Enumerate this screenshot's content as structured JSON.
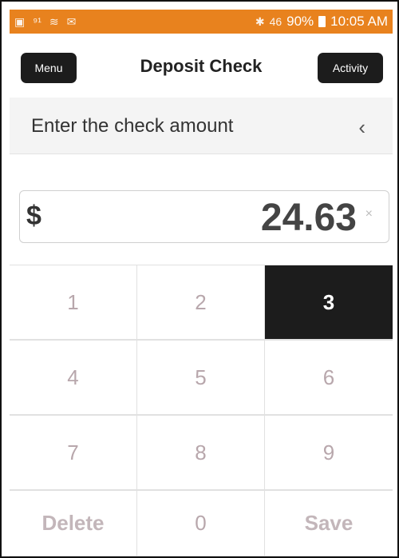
{
  "status_bar": {
    "time": "10:05 AM",
    "battery": "90%",
    "signal_text": "46"
  },
  "header": {
    "title": "Deposit Check",
    "menu_label": "Menu",
    "activity_label": "Activity"
  },
  "instruction": {
    "text": "Enter the check amount",
    "back_icon": "chevron-left"
  },
  "amount": {
    "currency": "$",
    "value": "24.63",
    "clear_icon": "×"
  },
  "keypad": {
    "k1": "1",
    "k2": "2",
    "k3": "3",
    "k4": "4",
    "k5": "5",
    "k6": "6",
    "k7": "7",
    "k8": "8",
    "k9": "9",
    "delete": "Delete",
    "k0": "0",
    "save": "Save",
    "active_key": "3"
  },
  "colors": {
    "status_bar": "#e8821e",
    "button_dark": "#1c1c1c",
    "key_text": "#b8a7ac"
  }
}
